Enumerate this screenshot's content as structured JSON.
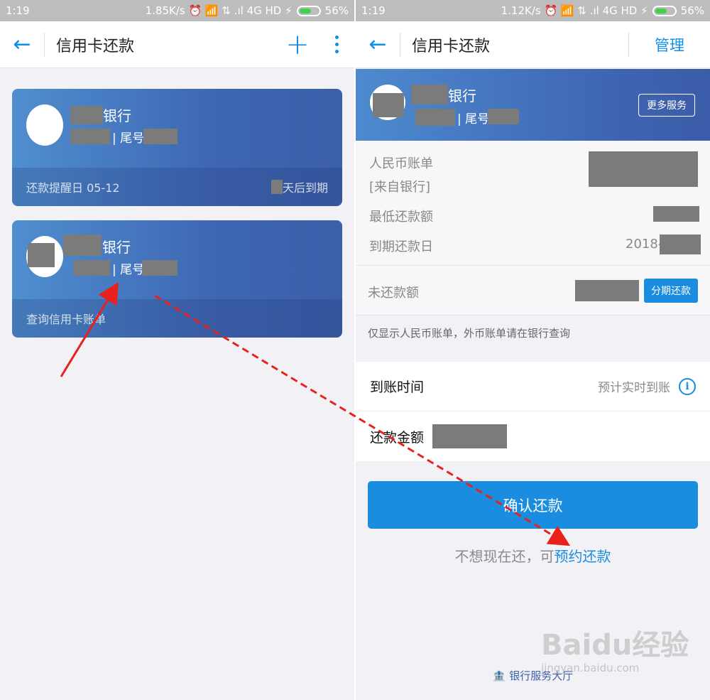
{
  "left": {
    "status": {
      "time": "1:19",
      "info": "1.85K/s ⏰ 📶 ⇅ .ıl 4G HD ⚡",
      "battery": "56%"
    },
    "title": "信用卡还款",
    "cards": [
      {
        "bank": "银行",
        "tail": "| 尾号",
        "footer_left": "还款提醒日 05-12",
        "footer_right": "天后到期"
      },
      {
        "bank": "银行",
        "tail": "| 尾号",
        "footer_left": "查询信用卡账单"
      }
    ]
  },
  "right": {
    "status": {
      "time": "1:19",
      "info": "1.12K/s ⏰ 📶 ⇅ .ıl 4G HD ⚡",
      "battery": "56%"
    },
    "title": "信用卡还款",
    "manage": "管理",
    "header": {
      "bank": "银行",
      "tail": "| 尾号",
      "more_services": "更多服务"
    },
    "bill": {
      "rmb_bill": "人民币账单",
      "from_bank": "[来自银行]",
      "min_payment": "最低还款额",
      "due_date": "到期还款日",
      "due_value": "2018-"
    },
    "unpaid": {
      "label": "未还款额",
      "installment": "分期还款"
    },
    "note": "仅显示人民币账单，外币账单请在银行查询",
    "arrival": {
      "label": "到账时间",
      "value": "预计实时到账"
    },
    "amount": {
      "label": "还款金额"
    },
    "confirm": "确认还款",
    "later_text": "不想现在还，可",
    "later_link": "预约还款",
    "bank_hall": "银行服务大厅"
  },
  "watermark": {
    "brand": "Baidu经验",
    "url": "jingyan.baidu.com"
  },
  "colors": {
    "accent": "#1a8de0",
    "card": "#3f67b4",
    "arrow": "#e8211d"
  }
}
